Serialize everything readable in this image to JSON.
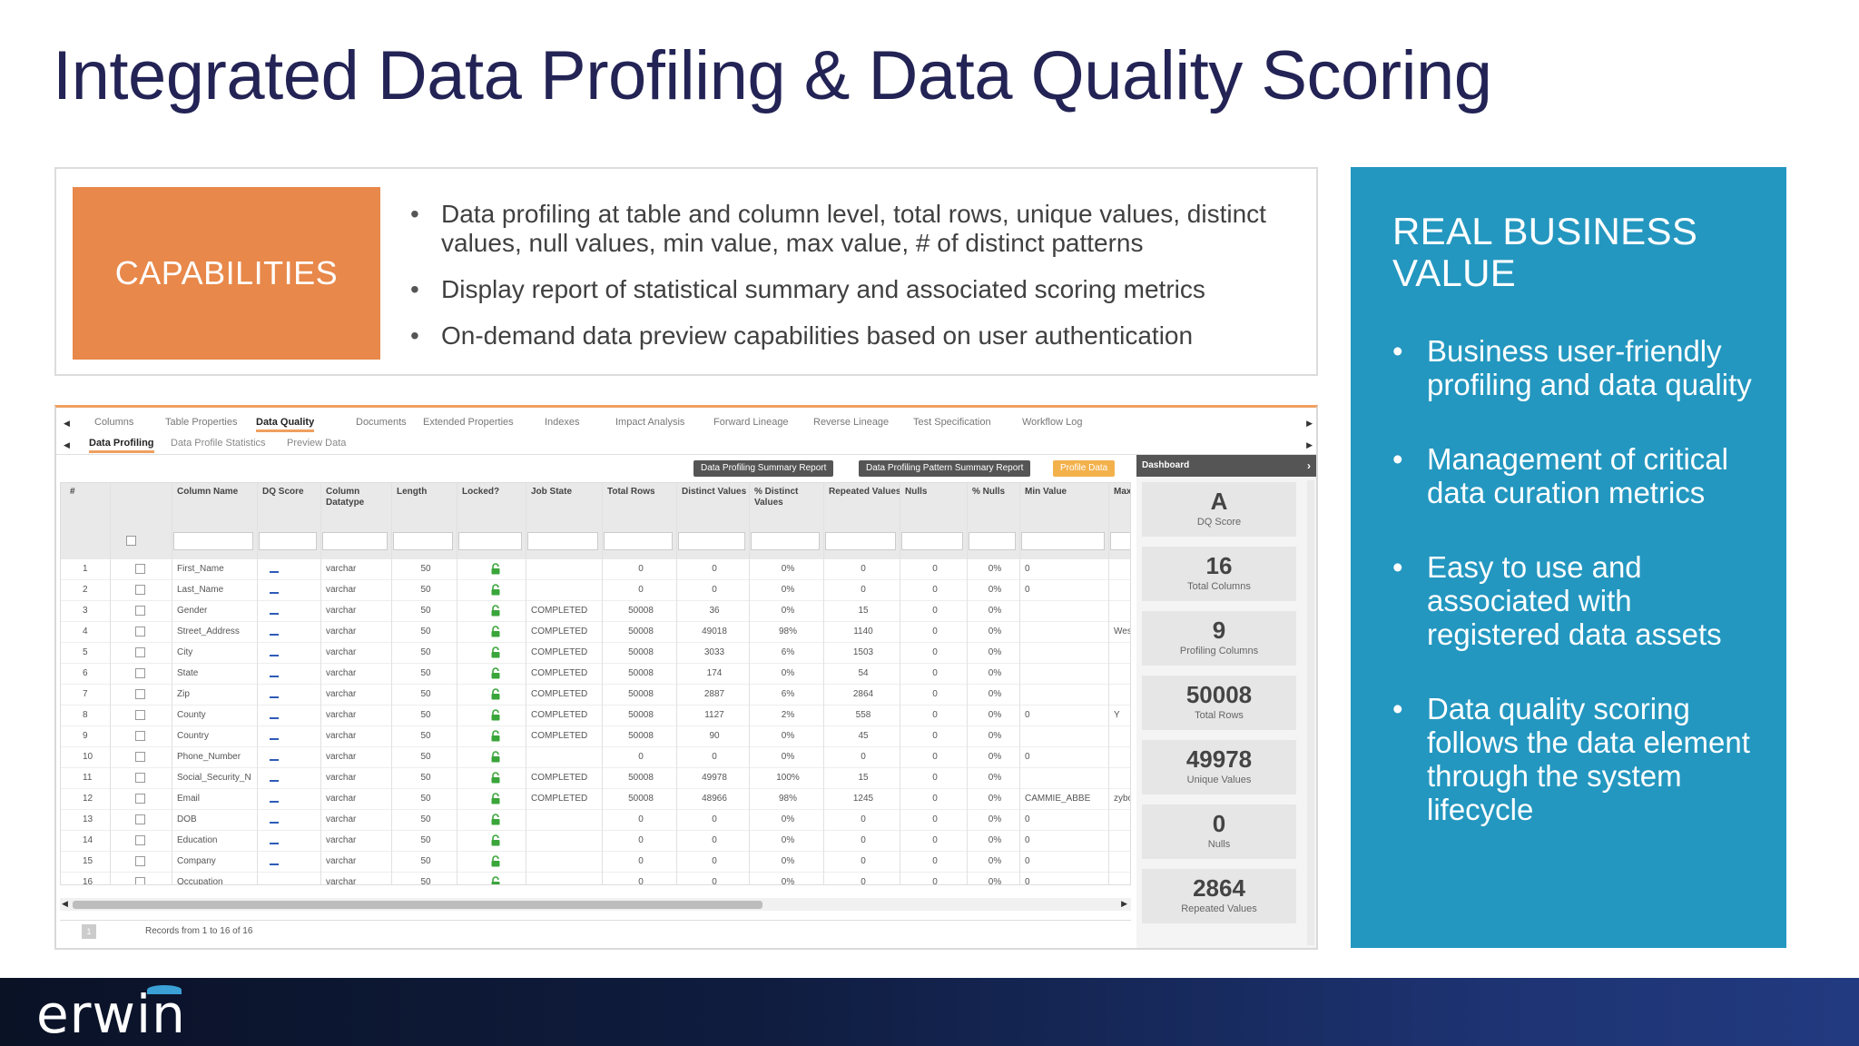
{
  "slide": {
    "title": "Integrated Data Profiling & Data Quality Scoring"
  },
  "capabilities": {
    "label": "CAPABILITIES",
    "items": [
      "Data profiling at table and column level, total rows, unique values, distinct values, null values, min value, max value, # of distinct patterns",
      "Display report of statistical summary and associated scoring metrics",
      "On-demand data preview capabilities based on user authentication"
    ]
  },
  "value": {
    "title": "REAL BUSINESS VALUE",
    "items": [
      "Business user-friendly profiling and data quality",
      "Management of critical data curation metrics",
      "Easy to use and associated with registered data assets",
      "Data quality scoring follows the data element through the system lifecycle"
    ]
  },
  "app": {
    "tabs": [
      "Columns",
      "Table Properties",
      "Data Quality",
      "Documents",
      "Extended Properties",
      "Indexes",
      "Impact Analysis",
      "Forward Lineage",
      "Reverse Lineage",
      "Test Specification",
      "Workflow Log"
    ],
    "active_tab": "Data Quality",
    "subtabs": [
      "Data Profiling",
      "Data Profile Statistics",
      "Preview Data"
    ],
    "active_subtab": "Data Profiling",
    "buttons": {
      "summary_report": "Data Profiling Summary Report",
      "pattern_report": "Data Profiling Pattern Summary Report",
      "profile_data": "Profile Data"
    },
    "grid": {
      "headers": [
        "#",
        "",
        "Column Name",
        "DQ Score",
        "Column Datatype",
        "Length",
        "Locked?",
        "Job State",
        "Total Rows",
        "Distinct Values",
        "% Distinct Values",
        "Repeated Values",
        "Nulls",
        "% Nulls",
        "Min Value",
        "Max Va"
      ],
      "rows": [
        [
          "1",
          "First_Name",
          "varchar",
          "50",
          "",
          "0",
          "0",
          "0%",
          "0",
          "0",
          "0%",
          "0",
          ""
        ],
        [
          "2",
          "Last_Name",
          "varchar",
          "50",
          "",
          "0",
          "0",
          "0%",
          "0",
          "0",
          "0%",
          "0",
          ""
        ],
        [
          "3",
          "Gender",
          "varchar",
          "50",
          "COMPLETED",
          "50008",
          "36",
          "0%",
          "15",
          "0",
          "0%",
          "",
          ""
        ],
        [
          "4",
          "Street_Address",
          "varchar",
          "50",
          "COMPLETED",
          "50008",
          "49018",
          "98%",
          "1140",
          "0",
          "0%",
          "",
          "West"
        ],
        [
          "5",
          "City",
          "varchar",
          "50",
          "COMPLETED",
          "50008",
          "3033",
          "6%",
          "1503",
          "0",
          "0%",
          "",
          ""
        ],
        [
          "6",
          "State",
          "varchar",
          "50",
          "COMPLETED",
          "50008",
          "174",
          "0%",
          "54",
          "0",
          "0%",
          "",
          ""
        ],
        [
          "7",
          "Zip",
          "varchar",
          "50",
          "COMPLETED",
          "50008",
          "2887",
          "6%",
          "2864",
          "0",
          "0%",
          "",
          ""
        ],
        [
          "8",
          "County",
          "varchar",
          "50",
          "COMPLETED",
          "50008",
          "1127",
          "2%",
          "558",
          "0",
          "0%",
          "0",
          "Y"
        ],
        [
          "9",
          "Country",
          "varchar",
          "50",
          "COMPLETED",
          "50008",
          "90",
          "0%",
          "45",
          "0",
          "0%",
          "",
          ""
        ],
        [
          "10",
          "Phone_Number",
          "varchar",
          "50",
          "",
          "0",
          "0",
          "0%",
          "0",
          "0",
          "0%",
          "0",
          ""
        ],
        [
          "11",
          "Social_Security_N",
          "varchar",
          "50",
          "COMPLETED",
          "50008",
          "49978",
          "100%",
          "15",
          "0",
          "0%",
          "",
          ""
        ],
        [
          "12",
          "Email",
          "varchar",
          "50",
          "COMPLETED",
          "50008",
          "48966",
          "98%",
          "1245",
          "0",
          "0%",
          "CAMMIE_ABBE",
          "zybol"
        ],
        [
          "13",
          "DOB",
          "varchar",
          "50",
          "",
          "0",
          "0",
          "0%",
          "0",
          "0",
          "0%",
          "0",
          ""
        ],
        [
          "14",
          "Education",
          "varchar",
          "50",
          "",
          "0",
          "0",
          "0%",
          "0",
          "0",
          "0%",
          "0",
          ""
        ],
        [
          "15",
          "Company",
          "varchar",
          "50",
          "",
          "0",
          "0",
          "0%",
          "0",
          "0",
          "0%",
          "0",
          ""
        ],
        [
          "16",
          "Occupation",
          "varchar",
          "50",
          "",
          "0",
          "0",
          "0%",
          "0",
          "0",
          "0%",
          "0",
          ""
        ]
      ]
    },
    "pager": {
      "page": "1",
      "text": "Records from 1 to 16 of 16"
    },
    "dashboard": {
      "title": "Dashboard",
      "metrics": [
        {
          "value": "A",
          "label": "DQ Score"
        },
        {
          "value": "16",
          "label": "Total Columns"
        },
        {
          "value": "9",
          "label": "Profiling Columns"
        },
        {
          "value": "50008",
          "label": "Total Rows"
        },
        {
          "value": "49978",
          "label": "Unique Values"
        },
        {
          "value": "0",
          "label": "Nulls"
        },
        {
          "value": "2864",
          "label": "Repeated Values"
        }
      ]
    }
  },
  "footer": {
    "logo": "erwin"
  },
  "colors": {
    "title": "#232355",
    "capabilities_bg": "#e8884a",
    "value_bg": "#2397c0",
    "accent": "#f0a060"
  }
}
